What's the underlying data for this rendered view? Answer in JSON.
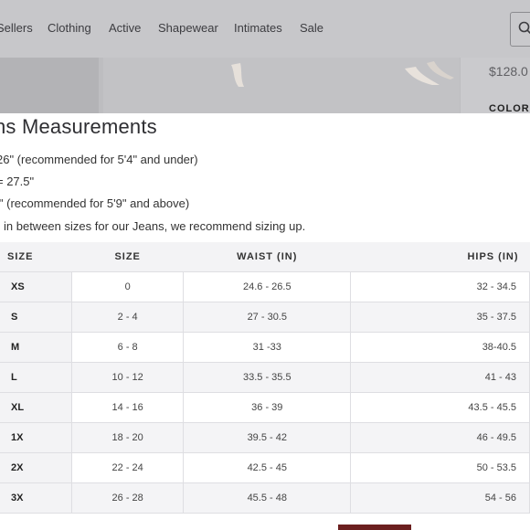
{
  "nav": {
    "items": [
      "Sellers",
      "Clothing",
      "Active",
      "Shapewear",
      "Intimates",
      "Sale"
    ]
  },
  "product": {
    "price": "$128.0",
    "colors_label": "COLORS"
  },
  "modal": {
    "title": "ns Measurements",
    "notes": [
      "26\" (recommended for 5'4\" and under)",
      "= 27.5\"",
      "l\" (recommended for 5'9\" and above)",
      "in between sizes for our Jeans, we recommend sizing up."
    ],
    "table": {
      "headers": [
        "SIZE",
        "SIZE",
        "WAIST (IN)",
        "HIPS (IN)"
      ],
      "rows": [
        [
          "XS",
          "0",
          "24.6 - 26.5",
          "32 - 34.5"
        ],
        [
          "S",
          "2 - 4",
          "27 - 30.5",
          "35 - 37.5"
        ],
        [
          "M",
          "6 - 8",
          "31 -33",
          "38-40.5"
        ],
        [
          "L",
          "10 - 12",
          "33.5 - 35.5",
          "41 - 43"
        ],
        [
          "XL",
          "14 - 16",
          "36 - 39",
          "43.5 - 45.5"
        ],
        [
          "1X",
          "18 - 20",
          "39.5 - 42",
          "46 - 49.5"
        ],
        [
          "2X",
          "22 - 24",
          "42.5 - 45",
          "50 - 53.5"
        ],
        [
          "3X",
          "26 - 28",
          "45.5 - 48",
          "54 - 56"
        ]
      ]
    }
  },
  "colors": {
    "overlay": "#c9c9cc",
    "header_bg": "#f3f3f5",
    "row_shade": "#f4f4f6",
    "border": "#dedee2"
  }
}
